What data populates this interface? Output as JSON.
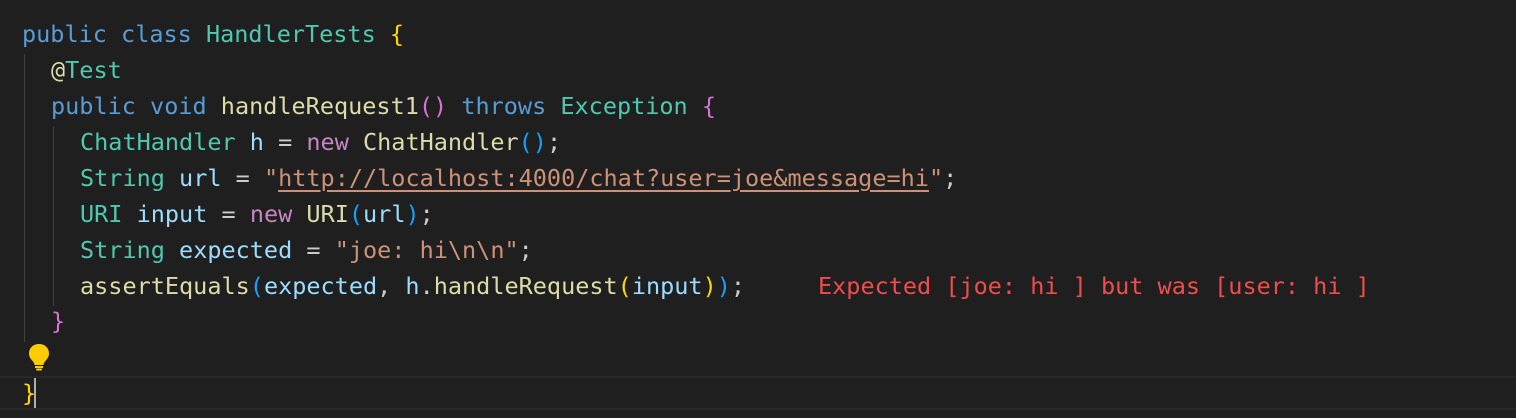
{
  "editor": {
    "language": "java",
    "lines": [
      {
        "tokens": [
          [
            "kw",
            "public"
          ],
          [
            "punc",
            " "
          ],
          [
            "kw",
            "class"
          ],
          [
            "punc",
            " "
          ],
          [
            "typ",
            "HandlerTests"
          ],
          [
            "punc",
            " "
          ],
          [
            "b1",
            "{"
          ]
        ]
      },
      {
        "tokens": [
          [
            "ann",
            "@"
          ],
          [
            "typ",
            "Test"
          ]
        ]
      },
      {
        "tokens": [
          [
            "kw",
            "public"
          ],
          [
            "punc",
            " "
          ],
          [
            "kw",
            "void"
          ],
          [
            "punc",
            " "
          ],
          [
            "fn",
            "handleRequest1"
          ],
          [
            "b2",
            "()"
          ],
          [
            "punc",
            " "
          ],
          [
            "kw",
            "throws"
          ],
          [
            "punc",
            " "
          ],
          [
            "typ",
            "Exception"
          ],
          [
            "punc",
            " "
          ],
          [
            "b2",
            "{"
          ]
        ]
      },
      {
        "tokens": [
          [
            "typ",
            "ChatHandler"
          ],
          [
            "punc",
            " "
          ],
          [
            "var",
            "h"
          ],
          [
            "punc",
            " = "
          ],
          [
            "ctl",
            "new"
          ],
          [
            "punc",
            " "
          ],
          [
            "fn",
            "ChatHandler"
          ],
          [
            "b3",
            "()"
          ],
          [
            "punc",
            ";"
          ]
        ]
      },
      {
        "tokens": [
          [
            "typ",
            "String"
          ],
          [
            "punc",
            " "
          ],
          [
            "var",
            "url"
          ],
          [
            "punc",
            " = "
          ],
          [
            "str",
            "\""
          ],
          [
            "url",
            "http://localhost:4000/chat?user=joe&message=hi"
          ],
          [
            "str",
            "\""
          ],
          [
            "punc",
            ";"
          ]
        ]
      },
      {
        "tokens": [
          [
            "typ",
            "URI"
          ],
          [
            "punc",
            " "
          ],
          [
            "var",
            "input"
          ],
          [
            "punc",
            " = "
          ],
          [
            "ctl",
            "new"
          ],
          [
            "punc",
            " "
          ],
          [
            "fn",
            "URI"
          ],
          [
            "b3",
            "("
          ],
          [
            "var",
            "url"
          ],
          [
            "b3",
            ")"
          ],
          [
            "punc",
            ";"
          ]
        ]
      },
      {
        "tokens": [
          [
            "typ",
            "String"
          ],
          [
            "punc",
            " "
          ],
          [
            "var",
            "expected"
          ],
          [
            "punc",
            " = "
          ],
          [
            "str",
            "\"joe: hi\\n\\n\""
          ],
          [
            "punc",
            ";"
          ]
        ]
      },
      {
        "tokens": [
          [
            "fn",
            "assertEquals"
          ],
          [
            "b3",
            "("
          ],
          [
            "var",
            "expected"
          ],
          [
            "punc",
            ", "
          ],
          [
            "var",
            "h"
          ],
          [
            "punc",
            "."
          ],
          [
            "fn",
            "handleRequest"
          ],
          [
            "b1",
            "("
          ],
          [
            "var",
            "input"
          ],
          [
            "b1",
            ")"
          ],
          [
            "b3",
            ")"
          ],
          [
            "punc",
            ";"
          ]
        ]
      },
      {
        "tokens": [
          [
            "b2",
            "}"
          ]
        ]
      },
      {
        "tokens": []
      },
      {
        "tokens": [
          [
            "b1",
            "}"
          ]
        ]
      }
    ],
    "inline_error": "Expected [joe: hi ] but was [user: hi ]",
    "lightbulb_icon": "lightbulb-icon",
    "colors": {
      "background": "#1f1f1f",
      "keyword": "#569cd6",
      "type": "#4ec9b0",
      "function": "#dcdcaa",
      "variable": "#9cdcfe",
      "string": "#ce9178",
      "error": "#f14c4c"
    }
  }
}
